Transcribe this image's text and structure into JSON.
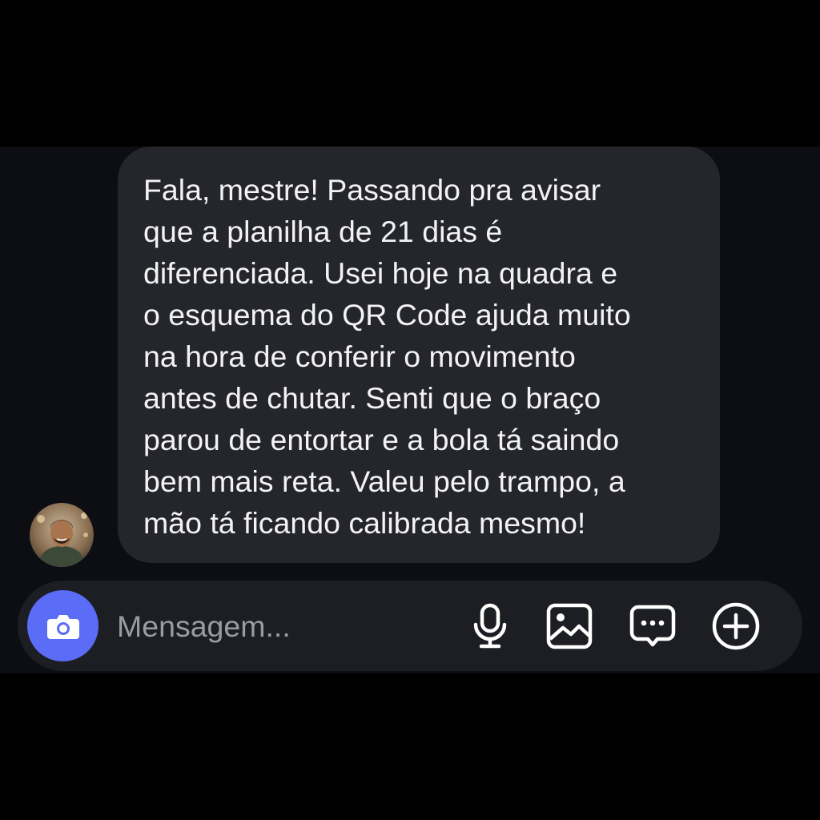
{
  "conversation": {
    "avatar": "contact-avatar-photo",
    "message_text": "Fala, mestre! Passando pra avisar\nque a planilha de 21 dias é\ndiferenciada. Usei hoje na quadra e\no esquema do QR Code ajuda muito\nna hora de conferir o movimento\nantes de chutar. Senti que o braço\nparou de entortar e a bola tá saindo\nbem mais reta. Valeu pelo trampo, a\nmão tá ficando calibrada mesmo!"
  },
  "composer": {
    "placeholder": "Mensagem...",
    "icons": {
      "camera": "camera-icon",
      "mic": "microphone-icon",
      "gallery": "image-gallery-icon",
      "sticker": "chat-bubble-icon",
      "add": "plus-circle-icon"
    }
  },
  "colors": {
    "background": "#000000",
    "chat_background": "#0c0e14",
    "bubble": "#24262c",
    "composer": "#1c1e24",
    "camera_button": "#5b6cf6",
    "text": "#f3f3f5",
    "placeholder": "#9a9ca3"
  }
}
